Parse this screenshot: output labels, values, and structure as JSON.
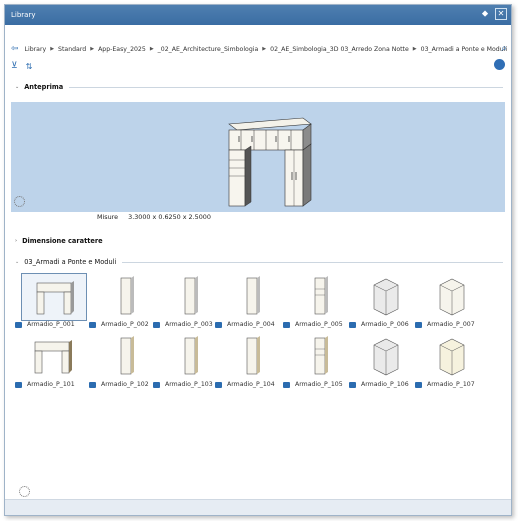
{
  "window": {
    "title": "Library"
  },
  "breadcrumb": {
    "items": [
      "Library",
      "Standard",
      "App-Easy_2025",
      "_02_AE_Architecture_Simbologia",
      "02_AE_Simbologia_3D",
      "03_Arredo Zona Notte",
      "03_Armadi a Ponte e Moduli"
    ]
  },
  "sections": {
    "preview": "Anteprima",
    "font_size": "Dimensione carattere",
    "folder": "03_Armadi a Ponte e Moduli"
  },
  "measures": {
    "label": "Misure",
    "value": "3.3000 x 0.6250 x 2.5000"
  },
  "items_row1": [
    "Armadio_P_001",
    "Armadio_P_002",
    "Armadio_P_003",
    "Armadio_P_004",
    "Armadio_P_005",
    "Armadio_P_006",
    "Armadio_P_007"
  ],
  "items_row2": [
    "Armadio_P_101",
    "Armadio_P_102",
    "Armadio_P_103",
    "Armadio_P_104",
    "Armadio_P_105",
    "Armadio_P_106",
    "Armadio_P_107"
  ],
  "colors": {
    "titlebar": "#3a6da3",
    "preview_bg": "#bdd3ea",
    "accent": "#2b6cb0"
  }
}
